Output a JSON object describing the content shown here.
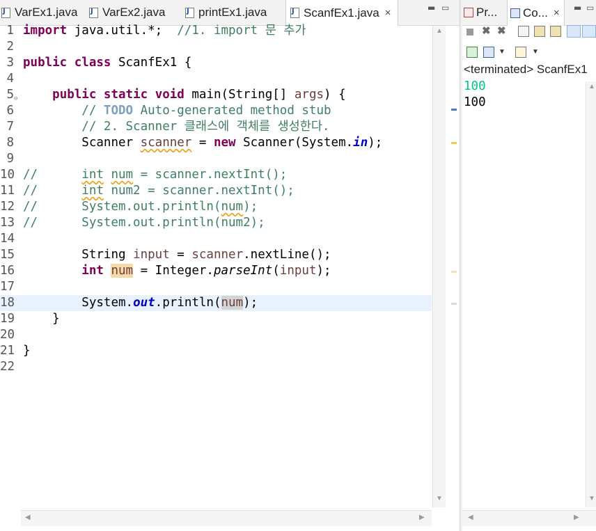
{
  "editor": {
    "tabs": [
      {
        "label": "VarEx1.java",
        "active": false
      },
      {
        "label": "VarEx2.java",
        "active": false
      },
      {
        "label": "printEx1.java",
        "active": false
      },
      {
        "label": "ScanfEx1.java",
        "active": true,
        "close": "×"
      }
    ],
    "window_controls": {
      "minimize": "▬",
      "maximize": "▭"
    },
    "line_numbers": [
      "1",
      "2",
      "3",
      "4",
      "5",
      "6",
      "7",
      "8",
      "9",
      "10",
      "11",
      "12",
      "13",
      "14",
      "15",
      "16",
      "17",
      "18",
      "19",
      "20",
      "21",
      "22"
    ],
    "code": {
      "l1_kw": "import",
      "l1_text": " java.util.*;  ",
      "l1_comment": "//1. import 문 추가",
      "l3_kw1": "public",
      "l3_kw2": "class",
      "l3_text": " ScanfEx1 {",
      "l5_kw1": "public",
      "l5_kw2": "static",
      "l5_kw3": "void",
      "l5_text": " main(String[] ",
      "l5_param": "args",
      "l5_end": ") {",
      "l6_c1": "// ",
      "l6_todo": "TODO",
      "l6_c2": " Auto-generated method stub",
      "l7_comment": "// 2. Scanner 클래스에 객체를 생성한다.",
      "l8_t1": "Scanner ",
      "l8_var": "scanner",
      "l8_t2": " = ",
      "l8_kw": "new",
      "l8_t3": " Scanner(System.",
      "l8_fld": "in",
      "l8_t4": ");",
      "l10_c": "//      ",
      "l10_w": "int",
      "l10_t": " ",
      "l10_w2": "num",
      "l10_r": " = scanner.nextInt();",
      "l11_c": "//      ",
      "l11_w": "int",
      "l11_t": " num2 = scanner.nextInt();",
      "l12_c": "//      System.out.println(",
      "l12_w": "num",
      "l12_r": ");",
      "l13_c": "//      System.out.println(num2);",
      "l15_t1": "String ",
      "l15_var": "input",
      "l15_t2": " = ",
      "l15_var2": "scanner",
      "l15_t3": ".nextLine();",
      "l16_kw": "int",
      "l16_t1": " ",
      "l16_var": "num",
      "l16_t2": " = Integer.",
      "l16_ital": "parseInt",
      "l16_t3": "(",
      "l16_var2": "input",
      "l16_t4": ");",
      "l18_t1": "System.",
      "l18_fld": "out",
      "l18_t2": ".println(",
      "l18_var": "num",
      "l18_t3": ");",
      "l19": "}",
      "l21": "}"
    },
    "current_line": 18
  },
  "console": {
    "tabs": [
      {
        "label": "Pr...",
        "active": false
      },
      {
        "label": "Co...",
        "active": true,
        "close": "×"
      }
    ],
    "window_controls": {
      "minimize": "▬",
      "maximize": "▭"
    },
    "status": "<terminated> ScanfEx1",
    "output": [
      {
        "text": "100",
        "color": "#00c87f",
        "kind": "input"
      },
      {
        "text": "100",
        "color": "#000000",
        "kind": "output"
      }
    ]
  },
  "colors": {
    "keyword": "#7f0055",
    "comment": "#3f7f5f",
    "field": "#0000c0",
    "current_line": "#e8f2fe",
    "stdin": "#00c87f"
  }
}
